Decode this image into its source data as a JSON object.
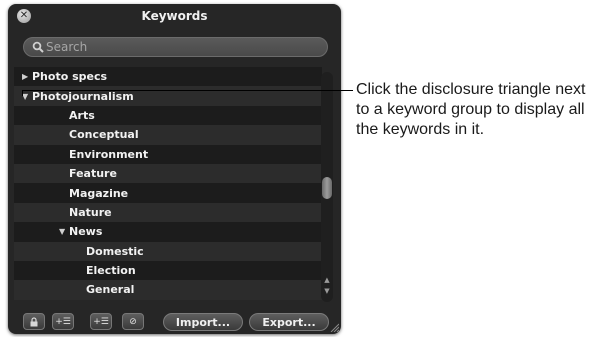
{
  "window": {
    "title": "Keywords"
  },
  "search": {
    "placeholder": "Search",
    "value": ""
  },
  "keywords": [
    {
      "label": "Photo specs",
      "level": 0,
      "disclosure": "collapsed"
    },
    {
      "label": "Photojournalism",
      "level": 0,
      "disclosure": "expanded"
    },
    {
      "label": "Arts",
      "level": 1,
      "disclosure": "none"
    },
    {
      "label": "Conceptual",
      "level": 1,
      "disclosure": "none"
    },
    {
      "label": "Environment",
      "level": 1,
      "disclosure": "none"
    },
    {
      "label": "Feature",
      "level": 1,
      "disclosure": "none"
    },
    {
      "label": "Magazine",
      "level": 1,
      "disclosure": "none"
    },
    {
      "label": "Nature",
      "level": 1,
      "disclosure": "none"
    },
    {
      "label": "News",
      "level": 1,
      "disclosure": "expanded"
    },
    {
      "label": "Domestic",
      "level": 2,
      "disclosure": "none"
    },
    {
      "label": "Election",
      "level": 2,
      "disclosure": "none"
    },
    {
      "label": "General",
      "level": 2,
      "disclosure": "none"
    }
  ],
  "footer": {
    "import_label": "Import...",
    "export_label": "Export...",
    "icons": [
      "lock-icon",
      "add-keyword-icon",
      "add-subkeyword-icon",
      "remove-keyword-icon"
    ]
  },
  "callout": {
    "text": "Click the disclosure triangle next to a keyword group to display all the keywords in it."
  },
  "colors": {
    "panel_bg": "#262626",
    "row_dark": "#1c1c1c",
    "row_light": "#2c2c2c",
    "text": "#f2f2f2"
  }
}
